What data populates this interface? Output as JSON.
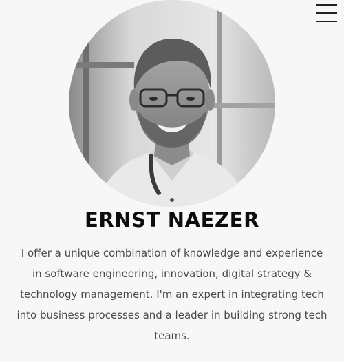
{
  "header": {
    "menu_icon": "hamburger-menu-icon"
  },
  "profile": {
    "photo_icon": "portrait-photo",
    "name": "ERNST NAEZER",
    "bio": "I offer a unique combination of knowledge and experience in software engineering, innovation, digital strategy & technology management. I'm an expert in integrating tech into business processes and a leader in building strong tech teams."
  },
  "colors": {
    "background": "#f7f7f7",
    "name_text": "#0d0d0d",
    "bio_text": "#4a4a4a"
  }
}
